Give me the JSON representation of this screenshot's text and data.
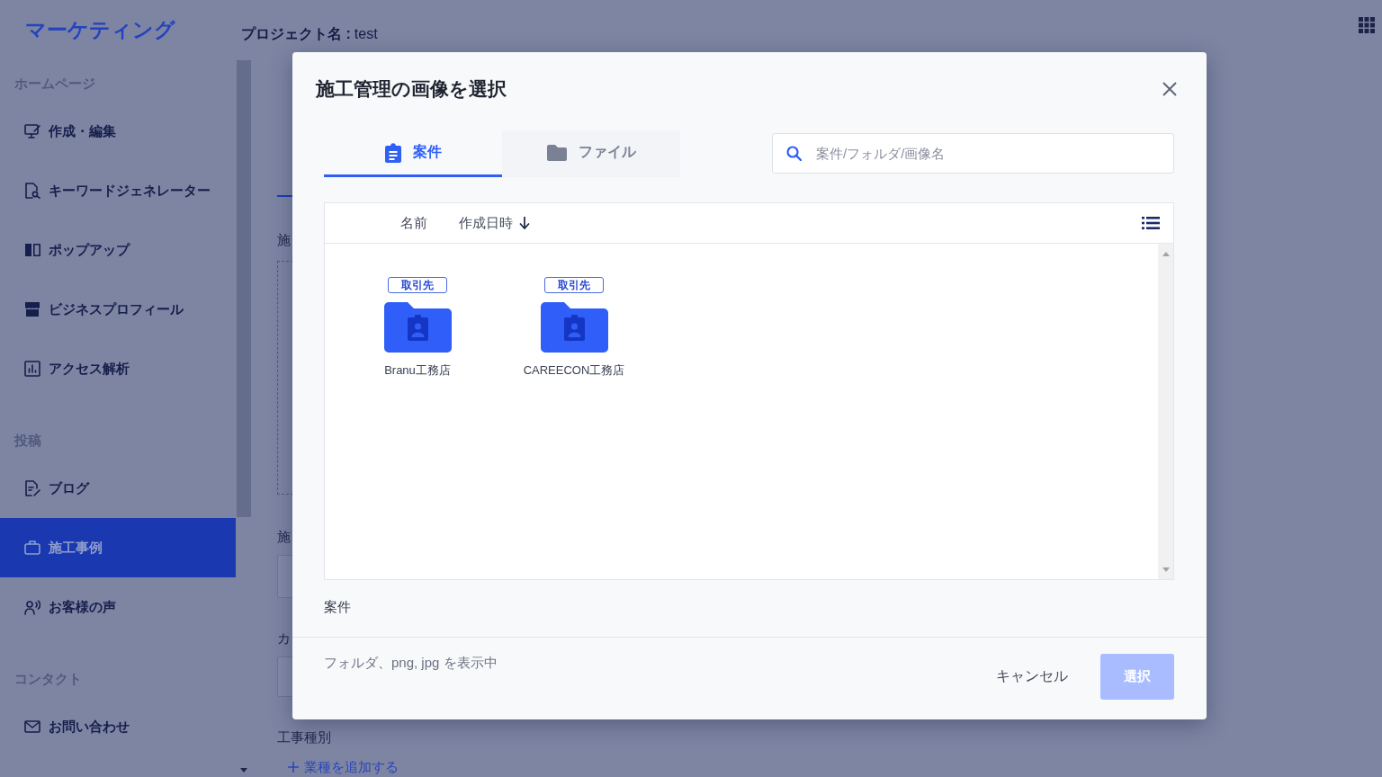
{
  "topbar": {
    "logo": "マーケティング",
    "project_label": "プロジェクト名 :",
    "project_name": "test"
  },
  "sidebar": {
    "sections": [
      {
        "title": "ホームページ",
        "items": [
          {
            "label": "作成・編集",
            "selected": false
          },
          {
            "label": "キーワードジェネレーター",
            "selected": false
          },
          {
            "label": "ポップアップ",
            "selected": false
          },
          {
            "label": "ビジネスプロフィール",
            "selected": false
          },
          {
            "label": "アクセス解析",
            "selected": false
          }
        ]
      },
      {
        "title": "投稿",
        "items": [
          {
            "label": "ブログ",
            "selected": false
          },
          {
            "label": "施工事例",
            "selected": true
          },
          {
            "label": "お客様の声",
            "selected": false
          }
        ]
      },
      {
        "title": "コンタクト",
        "items": [
          {
            "label": "お問い合わせ",
            "selected": false
          }
        ]
      }
    ]
  },
  "page": {
    "fields": [
      {
        "label": "施",
        "kind": "dropzone"
      },
      {
        "label": "施",
        "kind": "input"
      },
      {
        "label": "カ",
        "kind": "input"
      }
    ],
    "section_label": "工事種別",
    "add_link": "業種を追加する"
  },
  "dialog": {
    "title": "施工管理の画像を選択",
    "tabs": [
      {
        "label": "案件",
        "selected": true
      },
      {
        "label": "ファイル",
        "selected": false
      }
    ],
    "search": {
      "placeholder": "案件/フォルダ/画像名"
    },
    "columns": [
      {
        "label": "名前",
        "sorted": false
      },
      {
        "label": "作成日時",
        "sorted": true
      }
    ],
    "items": [
      {
        "tag": "取引先",
        "name": "Branu工務店"
      },
      {
        "tag": "取引先",
        "name": "CAREECON工務店"
      }
    ],
    "path": "案件",
    "filter_note": "フォルダ、png, jpg を表示中",
    "buttons": [
      {
        "label": "キャンセル",
        "kind": "text",
        "disabled": false
      },
      {
        "label": "選択",
        "kind": "primary",
        "disabled": true
      }
    ]
  }
}
